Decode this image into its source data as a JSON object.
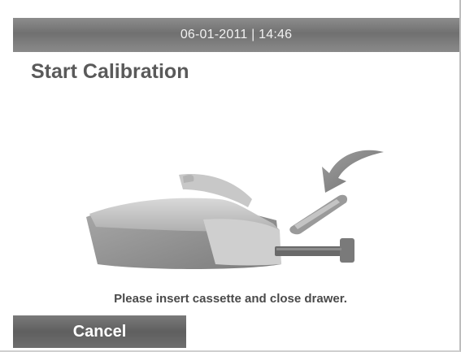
{
  "status_bar": {
    "datetime": "06-01-2011 | 14:46"
  },
  "page": {
    "title": "Start Calibration"
  },
  "illustration": {
    "icon": "cassette-insert-illustration"
  },
  "instruction": {
    "text": "Please insert cassette and close drawer."
  },
  "actions": {
    "cancel_label": "Cancel"
  },
  "colors": {
    "bar": "#787878",
    "title": "#5a5a5a",
    "text": "#4a4a4a"
  }
}
